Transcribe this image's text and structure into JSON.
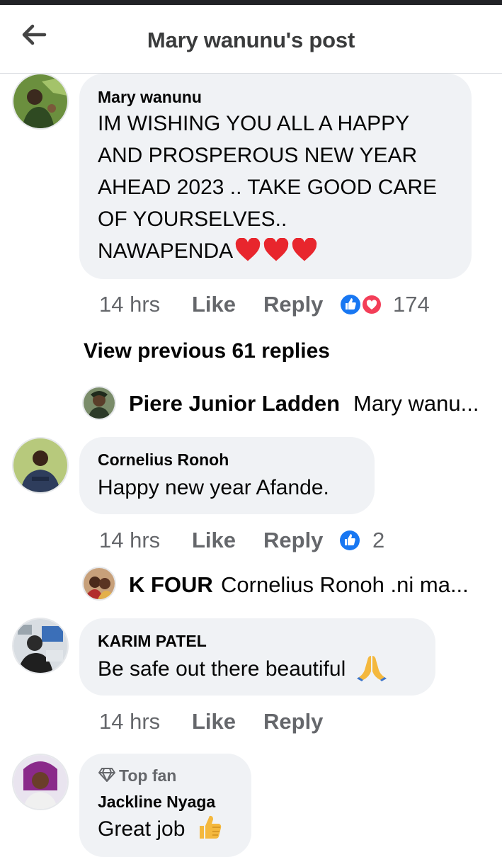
{
  "header": {
    "title": "Mary wanunu's post"
  },
  "post": {
    "author": "Mary wanunu",
    "text_lines": [
      "IM WISHING YOU ALL A HAPPY",
      "AND PROSPEROUS NEW YEAR",
      "AHEAD 2023 .. TAKE GOOD CARE",
      "OF YOURSELVES..",
      "NAWAPENDA"
    ],
    "time": "14 hrs",
    "like_label": "Like",
    "reply_label": "Reply",
    "reaction_count": "174",
    "reactions": [
      "like-icon",
      "love-icon"
    ]
  },
  "view_previous": "View previous 61 replies",
  "reply_previews": [
    {
      "name": "Piere Junior Ladden",
      "text": "Mary wanu..."
    },
    {
      "name": "K FOUR",
      "text": "Cornelius Ronoh .ni ma..."
    }
  ],
  "comments": [
    {
      "author": "Cornelius Ronoh",
      "text": "Happy new year Afande.",
      "time": "14 hrs",
      "like_label": "Like",
      "reply_label": "Reply",
      "reaction_count": "2"
    },
    {
      "author": "KARIM PATEL",
      "text": "Be safe out there beautiful",
      "time": "14 hrs",
      "like_label": "Like",
      "reply_label": "Reply"
    },
    {
      "badge": "Top fan",
      "author": "Jackline Nyaga",
      "text": "Great job"
    }
  ],
  "colors": {
    "like_blue": "#1877f2",
    "love_red": "#f33e58",
    "meta_gray": "#65676b",
    "bubble": "#f0f2f5"
  }
}
